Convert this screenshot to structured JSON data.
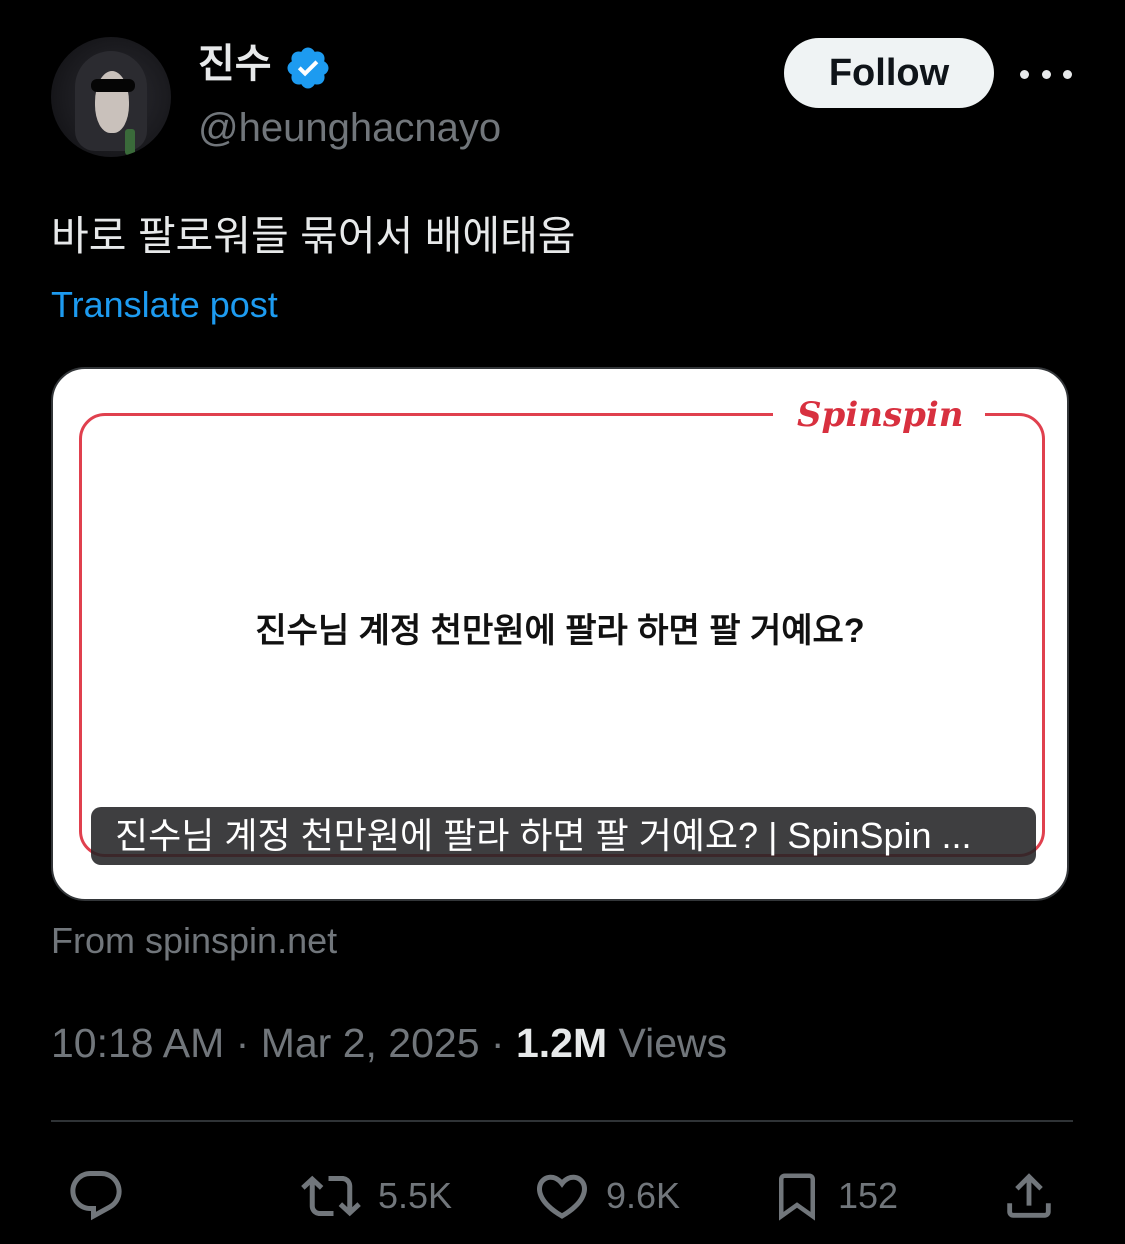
{
  "author": {
    "display_name": "진수",
    "handle": "@heunghacnayo",
    "verified": true,
    "follow_label": "Follow"
  },
  "post": {
    "text": "바로 팔로워들 묶어서 배에태움",
    "translate_label": "Translate post"
  },
  "card": {
    "logo_text": "Spinspin",
    "question": "진수님 계정 천만원에 팔라 하면 팔 거예요?",
    "title": "진수님 계정 천만원에 팔라 하면 팔 거예요? | SpinSpin ...",
    "source": "From spinspin.net"
  },
  "meta": {
    "time": "10:18 AM",
    "date": "Mar 2, 2025",
    "views_count": "1.2M",
    "views_label": "Views",
    "separator": "·"
  },
  "actions": {
    "reposts": "5.5K",
    "likes": "9.6K",
    "bookmarks": "152"
  },
  "colors": {
    "accent": "#1d9bf0",
    "card_red": "#e0404e",
    "muted": "#71767b"
  }
}
